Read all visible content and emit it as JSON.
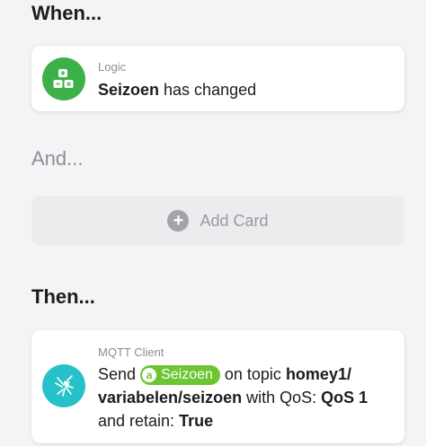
{
  "when": {
    "title": "When...",
    "card": {
      "app": "Logic",
      "icon": "logic-icon",
      "icon_color": "#3db149",
      "variable": "Seizoen",
      "text": " has changed"
    }
  },
  "and": {
    "title": "And...",
    "add_card_label": "Add Card",
    "icon": "plus-circle-icon"
  },
  "then": {
    "title": "Then...",
    "card": {
      "app": "MQTT Client",
      "icon": "mqtt-mosquito-icon",
      "icon_color": "#27c2c9",
      "send": "Send",
      "token_badge": "a",
      "token_label": "Seizoen",
      "token_color": "#6cc531",
      "on_topic": " on topic ",
      "topic": "homey1/​variabelen/seizoen",
      "with_qos": " with QoS: ",
      "qos": "QoS 1",
      "and_retain": " and retain: ",
      "retain": "True"
    }
  }
}
